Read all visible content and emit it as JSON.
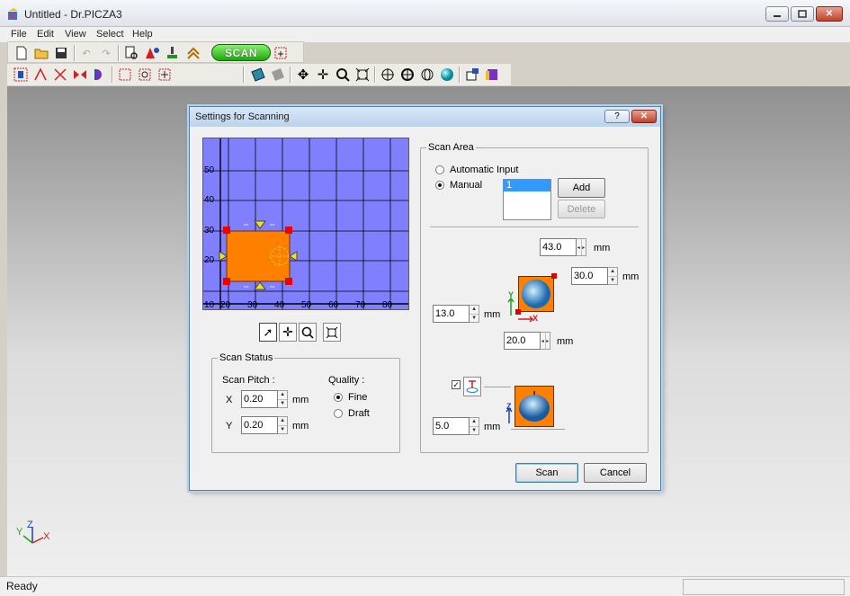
{
  "window": {
    "title": "Untitled - Dr.PICZA3"
  },
  "menu": [
    "File",
    "Edit",
    "View",
    "Select",
    "Help"
  ],
  "toolbar": {
    "scan_label": "SCAN"
  },
  "status": {
    "text": "Ready"
  },
  "axes_indicator": {
    "x": "X",
    "y": "Y",
    "z": "Z"
  },
  "dialog": {
    "title": "Settings for Scanning",
    "help_label": "?",
    "preview": {
      "x_ticks": [
        "20",
        "30",
        "40",
        "50",
        "60",
        "70",
        "80"
      ],
      "y_ticks": [
        "10",
        "20",
        "30",
        "40",
        "50"
      ]
    },
    "scan_status": {
      "title": "Scan Status",
      "pitch_label": "Scan Pitch :",
      "x_label": "X",
      "y_label": "Y",
      "x_value": "0.20",
      "y_value": "0.20",
      "unit": "mm",
      "quality_label": "Quality :",
      "quality_options": [
        "Fine",
        "Draft"
      ],
      "quality_selected": "Fine"
    },
    "scan_area": {
      "title": "Scan Area",
      "modes": [
        "Automatic Input",
        "Manual"
      ],
      "mode_selected": "Manual",
      "areas": [
        "1"
      ],
      "add_label": "Add",
      "delete_label": "Delete",
      "top_value": "43.0",
      "right_value": "30.0",
      "left_value": "13.0",
      "bottom_value": "20.0",
      "z_value": "5.0",
      "z_checked": true,
      "unit": "mm",
      "axis_y": "Y",
      "axis_x": "X",
      "axis_z": "Z"
    },
    "scan_button": "Scan",
    "cancel_button": "Cancel"
  },
  "colors": {
    "grid_bg": "#8080ff",
    "region": "#ff8000",
    "handle": "#ee0000",
    "accent_green": "#1fa80c"
  }
}
